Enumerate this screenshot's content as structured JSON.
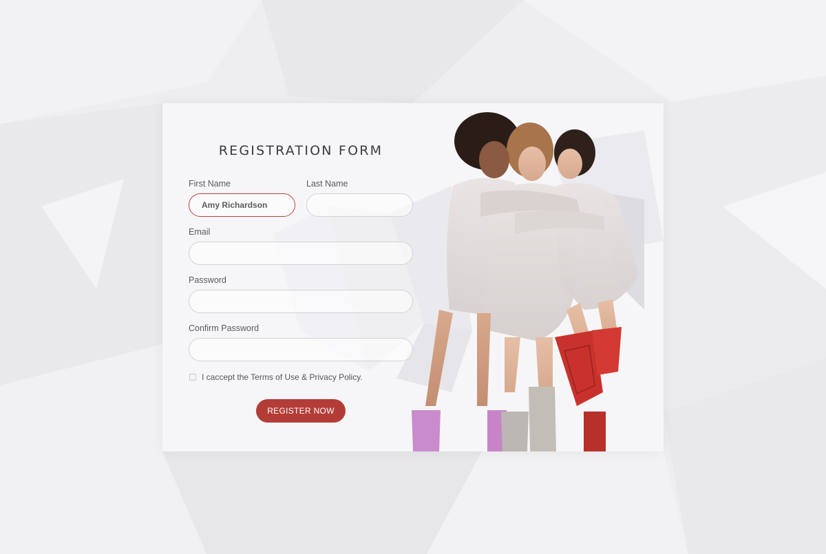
{
  "form": {
    "title": "REGISTRATION FORM",
    "first_name": {
      "label": "First Name",
      "value": "Amy Richardson"
    },
    "last_name": {
      "label": "Last Name",
      "value": ""
    },
    "email": {
      "label": "Email",
      "value": ""
    },
    "password": {
      "label": "Password",
      "value": ""
    },
    "confirm_password": {
      "label": "Confirm Password",
      "value": ""
    },
    "terms": {
      "label": "I caccept the Terms of Use & Privacy Policy.",
      "checked": false
    },
    "submit_label": "REGISTER NOW"
  },
  "colors": {
    "accent": "#b33c36",
    "active_border": "#b8403a",
    "text": "#3b3b3d",
    "background": "#eeeef0"
  },
  "image": {
    "icon": "photo-three-women-rain-boots"
  }
}
